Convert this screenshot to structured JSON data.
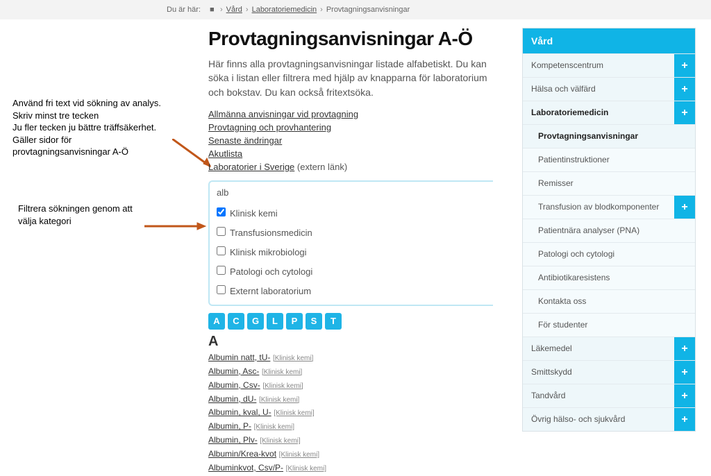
{
  "breadcrumb": {
    "prefix": "Du är här:",
    "home_glyph": "■",
    "items": [
      "Vård",
      "Laboratoriemedicin",
      "Provtagningsanvisningar"
    ]
  },
  "annotations": {
    "search_help": "Använd fri text vid sökning av analys.\nSkriv minst tre tecken\nJu fler tecken ju bättre träffsäkerhet.\nGäller sidor för\nprovtagningsanvisningar A-Ö",
    "filter_help": "Filtrera sökningen genom att\nvälja kategori"
  },
  "main": {
    "title": "Provtagningsanvisningar A-Ö",
    "intro": "Här finns alla provtagningsanvisningar listade alfabetiskt. Du kan söka i listan eller filtrera med hjälp av knapparna för laboratorium och bokstav. Du kan också fritextsöka.",
    "links": [
      {
        "label": "Allmänna anvisningar vid provtagning"
      },
      {
        "label": "Provtagning och provhantering"
      },
      {
        "label": "Senaste ändringar"
      },
      {
        "label": "Akutlista"
      },
      {
        "label": "Laboratorier i Sverige",
        "suffix": "(extern länk)"
      }
    ],
    "search_value": "alb",
    "filters": [
      {
        "label": "Klinisk kemi",
        "checked": true
      },
      {
        "label": "Transfusionsmedicin",
        "checked": false
      },
      {
        "label": "Klinisk mikrobiologi",
        "checked": false
      },
      {
        "label": "Patologi och cytologi",
        "checked": false
      },
      {
        "label": "Externt laboratorium",
        "checked": false
      }
    ],
    "letters": [
      "A",
      "C",
      "G",
      "L",
      "P",
      "S",
      "T"
    ],
    "group_heading": "A",
    "results": [
      {
        "label": "Albumin natt, tU-",
        "cat": "[Klinisk kemi]"
      },
      {
        "label": "Albumin, Asc-",
        "cat": "[Klinisk kemi]"
      },
      {
        "label": "Albumin, Csv-",
        "cat": "[Klinisk kemi]"
      },
      {
        "label": "Albumin, dU-",
        "cat": "[Klinisk kemi]"
      },
      {
        "label": "Albumin, kval, U-",
        "cat": "[Klinisk kemi]"
      },
      {
        "label": "Albumin, P-",
        "cat": "[Klinisk kemi]"
      },
      {
        "label": "Albumin, Plv-",
        "cat": "[Klinisk kemi]"
      },
      {
        "label": "Albumin/Krea-kvot",
        "cat": "[Klinisk kemi]"
      },
      {
        "label": "Albuminkvot, Csv/P-",
        "cat": "[Klinisk kemi]"
      }
    ]
  },
  "sidebar": {
    "header": "Vård",
    "items": [
      {
        "label": "Kompetenscentrum",
        "expand": true
      },
      {
        "label": "Hälsa och välfärd",
        "expand": true
      },
      {
        "label": "Laboratoriemedicin",
        "expand": true,
        "bold": true
      },
      {
        "label": "Provtagningsanvisningar",
        "sub": true,
        "active": true
      },
      {
        "label": "Patientinstruktioner",
        "sub": true
      },
      {
        "label": "Remisser",
        "sub": true
      },
      {
        "label": "Transfusion av blodkomponenter",
        "sub": true,
        "expand": true
      },
      {
        "label": "Patientnära analyser (PNA)",
        "sub": true
      },
      {
        "label": "Patologi och cytologi",
        "sub": true
      },
      {
        "label": "Antibiotikaresistens",
        "sub": true
      },
      {
        "label": "Kontakta oss",
        "sub": true
      },
      {
        "label": "För studenter",
        "sub": true
      },
      {
        "label": "Läkemedel",
        "expand": true
      },
      {
        "label": "Smittskydd",
        "expand": true
      },
      {
        "label": "Tandvård",
        "expand": true
      },
      {
        "label": "Övrig hälso- och sjukvård",
        "expand": true
      }
    ]
  }
}
